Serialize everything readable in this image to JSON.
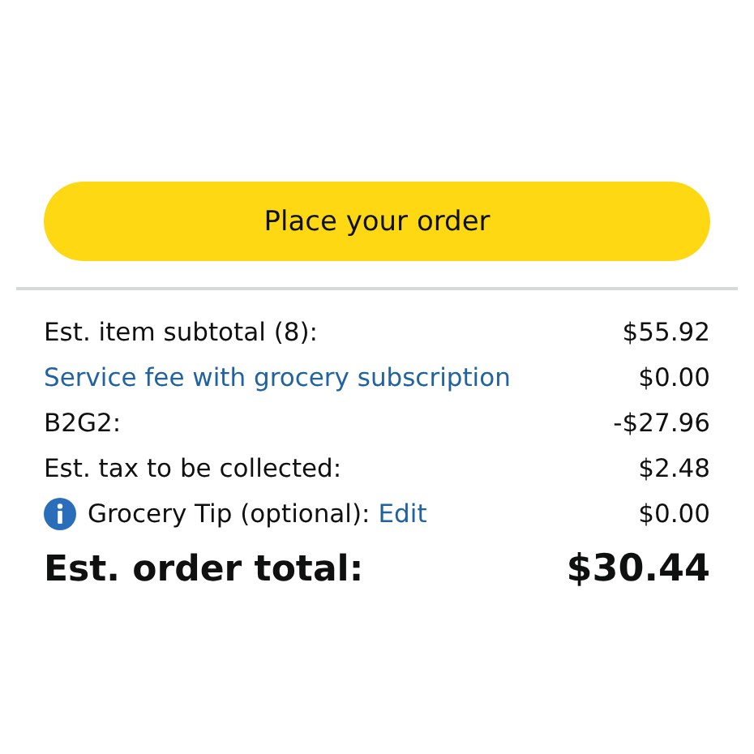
{
  "place_order_button": {
    "label": "Place your order"
  },
  "summary": [
    {
      "kind": "plain",
      "label": "Est. item subtotal (8):",
      "amount": "$55.92"
    },
    {
      "kind": "link",
      "label": "Service fee with grocery subscription",
      "amount": "$0.00"
    },
    {
      "kind": "plain",
      "label": "B2G2:",
      "amount": "-$27.96"
    },
    {
      "kind": "plain",
      "label": "Est. tax to be collected:",
      "amount": "$2.48"
    },
    {
      "kind": "info",
      "label": "Grocery Tip (optional):",
      "link": "Edit",
      "amount": "$0.00"
    }
  ],
  "total": {
    "label": "Est. order total:",
    "amount": "$30.44"
  }
}
